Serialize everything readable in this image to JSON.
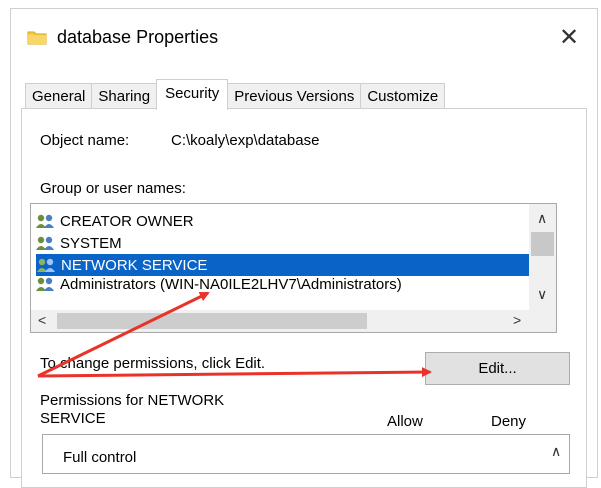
{
  "window": {
    "title": "database Properties",
    "close_glyph": "✕"
  },
  "tabs": [
    {
      "label": "General"
    },
    {
      "label": "Sharing"
    },
    {
      "label": "Security",
      "active": true
    },
    {
      "label": "Previous Versions"
    },
    {
      "label": "Customize"
    }
  ],
  "security": {
    "object_name_label": "Object name:",
    "object_name_value": "C:\\koaly\\exp\\database",
    "group_label": "Group or user names:",
    "users": [
      {
        "name": "CREATOR OWNER"
      },
      {
        "name": "SYSTEM"
      },
      {
        "name": "NETWORK SERVICE",
        "selected": true
      },
      {
        "name": "Administrators (WIN-NA0ILE2LHV7\\Administrators)"
      }
    ],
    "change_permissions_text": "To change permissions, click Edit.",
    "edit_button_label": "Edit...",
    "permissions_for_label": "Permissions for NETWORK SERVICE",
    "permissions_for_line1": "Permissions for NETWORK",
    "permissions_for_line2": "SERVICE",
    "allow_header": "Allow",
    "deny_header": "Deny",
    "permissions": [
      {
        "name": "Full control"
      }
    ]
  },
  "colors": {
    "selection": "#0a64c8",
    "annotation_arrow": "#e8322a"
  }
}
